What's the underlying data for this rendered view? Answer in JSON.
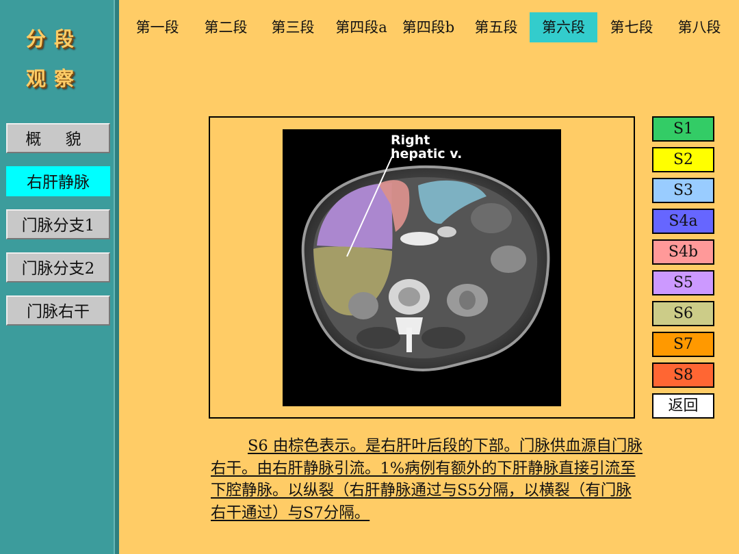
{
  "sidebar": {
    "title_line1": "分段",
    "title_line2": "观察",
    "items": [
      {
        "label": "概 貌",
        "active": false
      },
      {
        "label": "右肝静脉",
        "active": true
      },
      {
        "label": "门脉分支1",
        "active": false
      },
      {
        "label": "门脉分支2",
        "active": false
      },
      {
        "label": "门脉右干",
        "active": false
      }
    ]
  },
  "tabs": [
    {
      "label": "第一段",
      "active": false
    },
    {
      "label": "第二段",
      "active": false
    },
    {
      "label": "第三段",
      "active": false
    },
    {
      "label": "第四段a",
      "active": false
    },
    {
      "label": "第四段b",
      "active": false
    },
    {
      "label": "第五段",
      "active": false
    },
    {
      "label": "第六段",
      "active": true
    },
    {
      "label": "第七段",
      "active": false
    },
    {
      "label": "第八段",
      "active": false
    }
  ],
  "image": {
    "label_line1": "Right",
    "label_line2": "hepatic v."
  },
  "segments": [
    {
      "label": "S1",
      "color": "#33cc66"
    },
    {
      "label": "S2",
      "color": "#ffff00"
    },
    {
      "label": "S3",
      "color": "#99ccff"
    },
    {
      "label": "S4a",
      "color": "#6666ff"
    },
    {
      "label": "S4b",
      "color": "#ff9999"
    },
    {
      "label": "S5",
      "color": "#cc99ff"
    },
    {
      "label": "S6",
      "color": "#cccc88"
    },
    {
      "label": "S7",
      "color": "#ff9900"
    },
    {
      "label": "S8",
      "color": "#ff6633"
    },
    {
      "label": "返回",
      "color": "#ffffff"
    }
  ],
  "description": "S6 由棕色表示。是右肝叶后段的下部。门脉供血源自门脉右干。由右肝静脉引流。1%病例有额外的下肝静脉直接引流至下腔静脉。以纵裂（右肝静脉通过与S5分隔，以横裂（有门脉右干通过）与S7分隔。"
}
